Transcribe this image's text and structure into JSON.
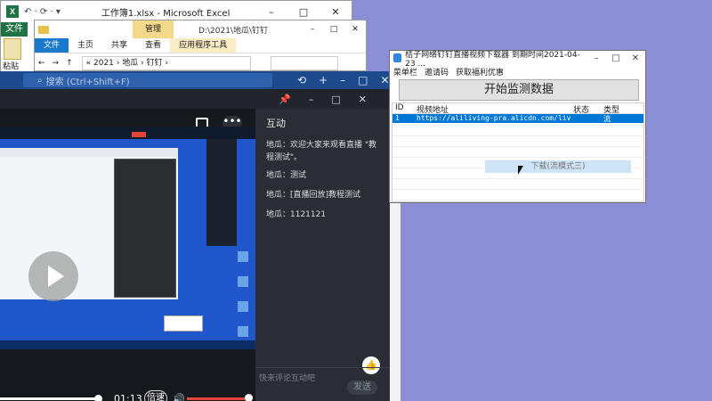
{
  "excel": {
    "title": "工作簿1.xlsx - Microsoft Excel",
    "logo": "X",
    "quick_access": "↶ · ⟳ · ▾",
    "file_tab": "文件",
    "paste_label": "粘贴",
    "controls": [
      "–",
      "□",
      "✕"
    ]
  },
  "explorer": {
    "manage_tab": "管理",
    "path_title": "D:\\2021\\地瓜\\钉钉",
    "menu": [
      "文件",
      "主页",
      "共享",
      "查看",
      "应用程序工具"
    ],
    "breadcrumb": "« 2021 › 地瓜 › 钉钉 ›",
    "controls": [
      "–",
      "□",
      "✕"
    ]
  },
  "dingtalk": {
    "search_placeholder": "搜索 (Ctrl+Shift+F)",
    "top_icons": [
      "⟲",
      "+",
      "–",
      "□",
      "✕"
    ],
    "sub_icons": [
      "📌",
      "–",
      "□",
      "✕"
    ],
    "player": {
      "time": "01:13",
      "speed_label": "倍速",
      "volume_icon": "🔊",
      "more_label": "•••"
    },
    "chat": {
      "title": "互动",
      "messages": [
        "地瓜：欢迎大家来观看直播 \"教程测试\"。",
        "地瓜：测试",
        "地瓜：[直播回放]教程测试",
        "地瓜：1121121"
      ],
      "input_placeholder": "快来评论互动吧",
      "send_label": "发送",
      "like_icon": "👍"
    }
  },
  "downloader": {
    "title": "桔子网络钉钉直播视频下载器   到期时间2021-04-23 ...",
    "controls": [
      "–",
      "□",
      "✕"
    ],
    "menu": [
      "菜单栏",
      "邀请码",
      "获取福利优惠"
    ],
    "start_button": "开始监测数据",
    "columns": [
      "ID",
      "视频地址",
      "状态",
      "类型"
    ],
    "rows": [
      {
        "id": "1",
        "url": "https://aliliving-pra.alicdn.com/live_...",
        "status": "",
        "type": "流"
      }
    ],
    "context_menu_item": "下载(流模式三)"
  }
}
